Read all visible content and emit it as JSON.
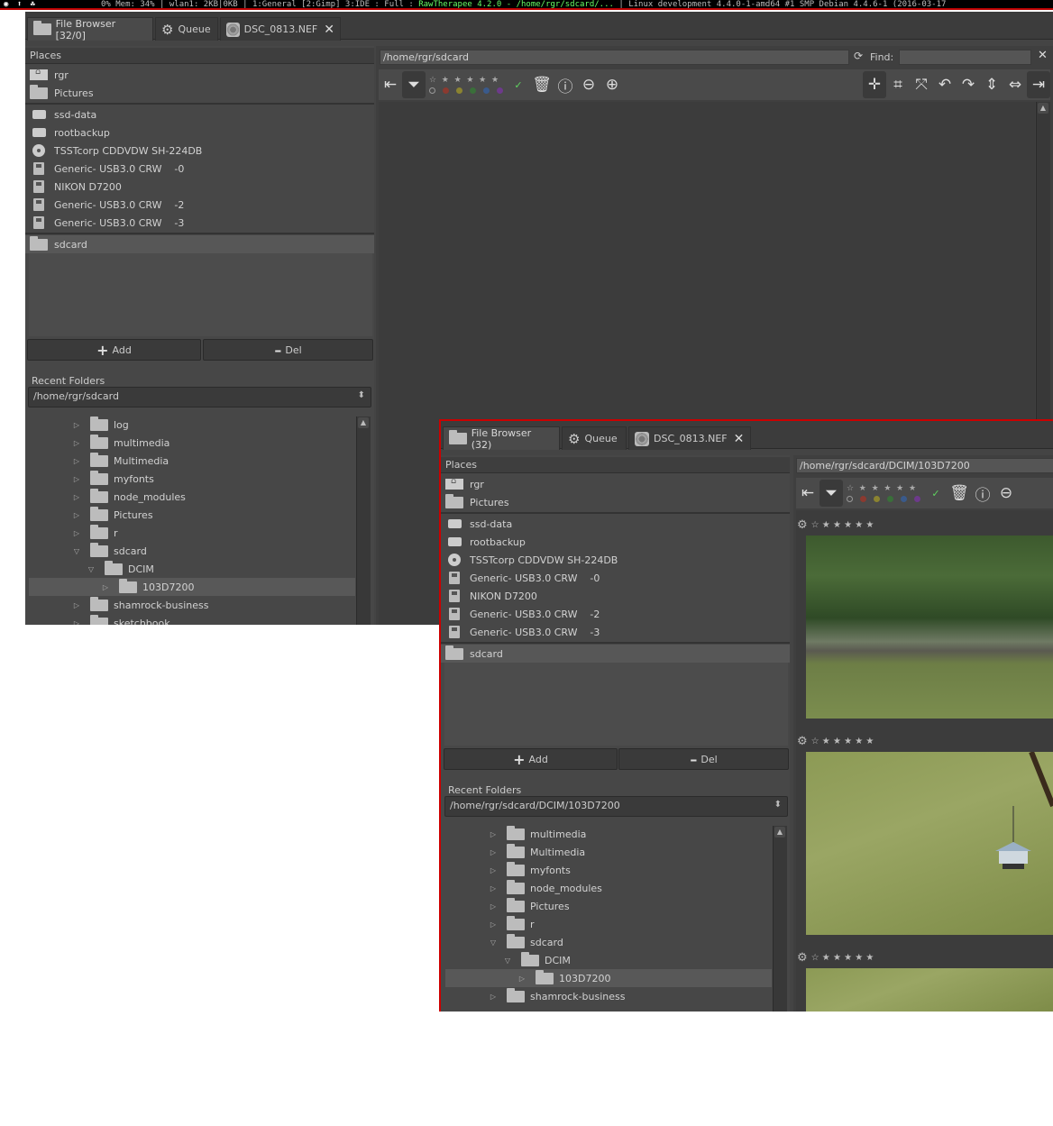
{
  "statusbar": {
    "tray": "◉ ⬆ ☘",
    "pre": "0% Mem:  34% | wlan1: 2KB|0KB  | 1:General [2:Gimp] 3:IDE : Full : ",
    "app": "RawTherapee 4.2.0 - /home/rgr/sdcard/...",
    "post": " | Linux development 4.4.0-1-amd64 #1 SMP Debian 4.4.6-1 (2016-03-17"
  },
  "back": {
    "tabs": {
      "file_browser": "File Browser [32/0]",
      "queue": "Queue",
      "editor": "DSC_0813.NEF"
    },
    "places_title": "Places",
    "places": [
      {
        "label": "rgr",
        "icon": "home-icon"
      },
      {
        "label": "Pictures",
        "icon": "folder-icon"
      }
    ],
    "devices": [
      {
        "label": "ssd-data",
        "icon": "drive-icon"
      },
      {
        "label": "rootbackup",
        "icon": "drive-icon"
      },
      {
        "label": "TSSTcorp CDDVDW SH-224DB",
        "icon": "disc-icon"
      },
      {
        "label": "Generic- USB3.0 CRW    -0",
        "icon": "floppy-icon"
      },
      {
        "label": "NIKON D7200",
        "icon": "floppy-icon"
      },
      {
        "label": "Generic- USB3.0 CRW    -2",
        "icon": "floppy-icon"
      },
      {
        "label": "Generic- USB3.0 CRW    -3",
        "icon": "floppy-icon"
      }
    ],
    "bookmark": "sdcard",
    "add": "Add",
    "del": "Del",
    "recent_title": "Recent Folders",
    "recent_value": "/home/rgr/sdcard",
    "tree": [
      {
        "label": "log",
        "exp": "▷",
        "depth": 0
      },
      {
        "label": "multimedia",
        "exp": "▷",
        "depth": 0
      },
      {
        "label": "Multimedia",
        "exp": "▷",
        "depth": 0
      },
      {
        "label": "myfonts",
        "exp": "▷",
        "depth": 0
      },
      {
        "label": "node_modules",
        "exp": "▷",
        "depth": 0
      },
      {
        "label": "Pictures",
        "exp": "▷",
        "depth": 0
      },
      {
        "label": "r",
        "exp": "▷",
        "depth": 0
      },
      {
        "label": "sdcard",
        "exp": "▽",
        "depth": 0
      },
      {
        "label": "DCIM",
        "exp": "▽",
        "depth": 1
      },
      {
        "label": "103D7200",
        "exp": "▷",
        "depth": 2,
        "selected": true
      },
      {
        "label": "shamrock-business",
        "exp": "▷",
        "depth": 0
      },
      {
        "label": "sketchbook",
        "exp": "▷",
        "depth": 0
      }
    ],
    "path": "/home/rgr/sdcard",
    "find_label": "Find:",
    "find_value": ""
  },
  "front": {
    "tabs": {
      "file_browser": "File Browser (32)",
      "queue": "Queue",
      "editor": "DSC_0813.NEF"
    },
    "places_title": "Places",
    "places": [
      {
        "label": "rgr",
        "icon": "home-icon"
      },
      {
        "label": "Pictures",
        "icon": "folder-icon"
      }
    ],
    "devices": [
      {
        "label": "ssd-data",
        "icon": "drive-icon"
      },
      {
        "label": "rootbackup",
        "icon": "drive-icon"
      },
      {
        "label": "TSSTcorp CDDVDW SH-224DB",
        "icon": "disc-icon"
      },
      {
        "label": "Generic- USB3.0 CRW    -0",
        "icon": "floppy-icon"
      },
      {
        "label": "NIKON D7200",
        "icon": "floppy-icon"
      },
      {
        "label": "Generic- USB3.0 CRW    -2",
        "icon": "floppy-icon"
      },
      {
        "label": "Generic- USB3.0 CRW    -3",
        "icon": "floppy-icon"
      }
    ],
    "bookmark": "sdcard",
    "add": "Add",
    "del": "Del",
    "recent_title": "Recent Folders",
    "recent_value": "/home/rgr/sdcard/DCIM/103D7200",
    "tree": [
      {
        "label": "multimedia",
        "exp": "▷",
        "depth": 0
      },
      {
        "label": "Multimedia",
        "exp": "▷",
        "depth": 0
      },
      {
        "label": "myfonts",
        "exp": "▷",
        "depth": 0
      },
      {
        "label": "node_modules",
        "exp": "▷",
        "depth": 0
      },
      {
        "label": "Pictures",
        "exp": "▷",
        "depth": 0
      },
      {
        "label": "r",
        "exp": "▷",
        "depth": 0
      },
      {
        "label": "sdcard",
        "exp": "▽",
        "depth": 0
      },
      {
        "label": "DCIM",
        "exp": "▽",
        "depth": 1
      },
      {
        "label": "103D7200",
        "exp": "▷",
        "depth": 2,
        "selected": true
      },
      {
        "label": "shamrock-business",
        "exp": "▷",
        "depth": 0
      }
    ],
    "path": "/home/rgr/sdcard/DCIM/103D7200",
    "thumb_stars": "☆ ★ ★ ★ ★ ★"
  },
  "colors": {
    "label_red": "#c0392b",
    "label_yellow": "#b5a21c",
    "label_green": "#3d8b3d",
    "label_blue": "#3867b5",
    "label_purple": "#8a44b0",
    "accent_green": "#5fd35f"
  }
}
